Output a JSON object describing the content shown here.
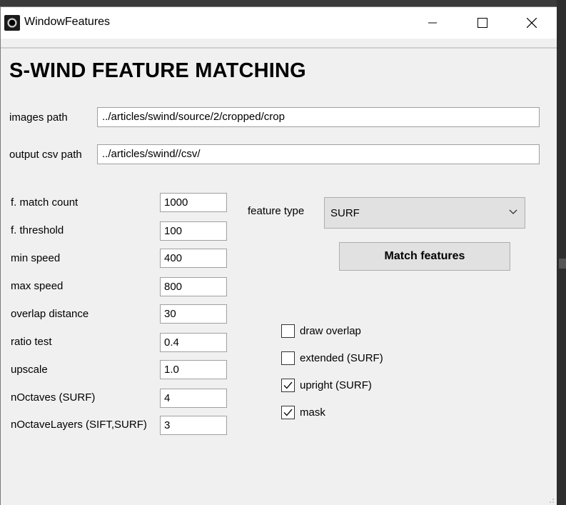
{
  "window": {
    "title": "WindowFeatures"
  },
  "heading": "S-WIND FEATURE MATCHING",
  "paths": {
    "images_label": "images path",
    "images_value": "../articles/swind/source/2/cropped/crop",
    "output_label": "output csv path",
    "output_value": "../articles/swind//csv/"
  },
  "params": [
    {
      "label": "f. match count",
      "value": "1000"
    },
    {
      "label": "f. threshold",
      "value": "100"
    },
    {
      "label": "min speed",
      "value": "400"
    },
    {
      "label": "max speed",
      "value": "800"
    },
    {
      "label": "overlap distance",
      "value": "30"
    },
    {
      "label": "ratio test",
      "value": "0.4"
    },
    {
      "label": "upscale",
      "value": "1.0"
    },
    {
      "label": "nOctaves (SURF)",
      "value": "4"
    },
    {
      "label": "nOctaveLayers (SIFT,SURF)",
      "value": "3"
    }
  ],
  "feature_type": {
    "label": "feature type",
    "selected": "SURF"
  },
  "match_button": "Match features",
  "checkboxes": [
    {
      "label": "draw overlap",
      "checked": false
    },
    {
      "label": "extended (SURF)",
      "checked": false
    },
    {
      "label": "upright (SURF)",
      "checked": true
    },
    {
      "label": "mask",
      "checked": true
    }
  ],
  "icons": {
    "app": "app-icon",
    "minimize": "minimize-icon",
    "maximize": "maximize-icon",
    "close": "close-icon",
    "dropdown": "chevron-down-icon",
    "check": "checkmark-icon",
    "resize": "resize-grip-icon"
  },
  "colors": {
    "window_bg": "#f0f0f0",
    "titlebar_bg": "#ffffff",
    "button_bg": "#e1e1e1"
  }
}
